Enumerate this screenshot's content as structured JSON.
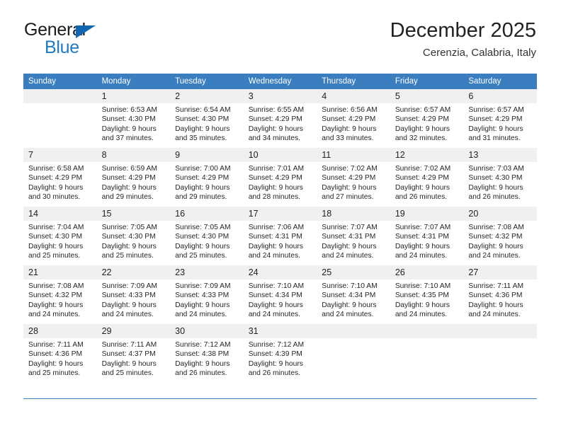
{
  "brand": {
    "name_top": "General",
    "name_bottom": "Blue",
    "accent_color": "#1f7ac4",
    "triangle_color": "#1265b0",
    "triangle_icon": "triangle-right-icon"
  },
  "header": {
    "title": "December 2025",
    "subtitle": "Cerenzia, Calabria, Italy"
  },
  "theme": {
    "header_bg": "#3a7ebf",
    "header_text": "#ffffff",
    "daynum_bg": "#f0f0f0",
    "cell_border": "#3a7ebf"
  },
  "weekday_headers": [
    "Sunday",
    "Monday",
    "Tuesday",
    "Wednesday",
    "Thursday",
    "Friday",
    "Saturday"
  ],
  "weeks": [
    [
      {
        "day": "",
        "sunrise": "",
        "sunset": "",
        "daylight_line1": "",
        "daylight_line2": ""
      },
      {
        "day": "1",
        "sunrise": "Sunrise: 6:53 AM",
        "sunset": "Sunset: 4:30 PM",
        "daylight_line1": "Daylight: 9 hours",
        "daylight_line2": "and 37 minutes."
      },
      {
        "day": "2",
        "sunrise": "Sunrise: 6:54 AM",
        "sunset": "Sunset: 4:30 PM",
        "daylight_line1": "Daylight: 9 hours",
        "daylight_line2": "and 35 minutes."
      },
      {
        "day": "3",
        "sunrise": "Sunrise: 6:55 AM",
        "sunset": "Sunset: 4:29 PM",
        "daylight_line1": "Daylight: 9 hours",
        "daylight_line2": "and 34 minutes."
      },
      {
        "day": "4",
        "sunrise": "Sunrise: 6:56 AM",
        "sunset": "Sunset: 4:29 PM",
        "daylight_line1": "Daylight: 9 hours",
        "daylight_line2": "and 33 minutes."
      },
      {
        "day": "5",
        "sunrise": "Sunrise: 6:57 AM",
        "sunset": "Sunset: 4:29 PM",
        "daylight_line1": "Daylight: 9 hours",
        "daylight_line2": "and 32 minutes."
      },
      {
        "day": "6",
        "sunrise": "Sunrise: 6:57 AM",
        "sunset": "Sunset: 4:29 PM",
        "daylight_line1": "Daylight: 9 hours",
        "daylight_line2": "and 31 minutes."
      }
    ],
    [
      {
        "day": "7",
        "sunrise": "Sunrise: 6:58 AM",
        "sunset": "Sunset: 4:29 PM",
        "daylight_line1": "Daylight: 9 hours",
        "daylight_line2": "and 30 minutes."
      },
      {
        "day": "8",
        "sunrise": "Sunrise: 6:59 AM",
        "sunset": "Sunset: 4:29 PM",
        "daylight_line1": "Daylight: 9 hours",
        "daylight_line2": "and 29 minutes."
      },
      {
        "day": "9",
        "sunrise": "Sunrise: 7:00 AM",
        "sunset": "Sunset: 4:29 PM",
        "daylight_line1": "Daylight: 9 hours",
        "daylight_line2": "and 29 minutes."
      },
      {
        "day": "10",
        "sunrise": "Sunrise: 7:01 AM",
        "sunset": "Sunset: 4:29 PM",
        "daylight_line1": "Daylight: 9 hours",
        "daylight_line2": "and 28 minutes."
      },
      {
        "day": "11",
        "sunrise": "Sunrise: 7:02 AM",
        "sunset": "Sunset: 4:29 PM",
        "daylight_line1": "Daylight: 9 hours",
        "daylight_line2": "and 27 minutes."
      },
      {
        "day": "12",
        "sunrise": "Sunrise: 7:02 AM",
        "sunset": "Sunset: 4:29 PM",
        "daylight_line1": "Daylight: 9 hours",
        "daylight_line2": "and 26 minutes."
      },
      {
        "day": "13",
        "sunrise": "Sunrise: 7:03 AM",
        "sunset": "Sunset: 4:30 PM",
        "daylight_line1": "Daylight: 9 hours",
        "daylight_line2": "and 26 minutes."
      }
    ],
    [
      {
        "day": "14",
        "sunrise": "Sunrise: 7:04 AM",
        "sunset": "Sunset: 4:30 PM",
        "daylight_line1": "Daylight: 9 hours",
        "daylight_line2": "and 25 minutes."
      },
      {
        "day": "15",
        "sunrise": "Sunrise: 7:05 AM",
        "sunset": "Sunset: 4:30 PM",
        "daylight_line1": "Daylight: 9 hours",
        "daylight_line2": "and 25 minutes."
      },
      {
        "day": "16",
        "sunrise": "Sunrise: 7:05 AM",
        "sunset": "Sunset: 4:30 PM",
        "daylight_line1": "Daylight: 9 hours",
        "daylight_line2": "and 25 minutes."
      },
      {
        "day": "17",
        "sunrise": "Sunrise: 7:06 AM",
        "sunset": "Sunset: 4:31 PM",
        "daylight_line1": "Daylight: 9 hours",
        "daylight_line2": "and 24 minutes."
      },
      {
        "day": "18",
        "sunrise": "Sunrise: 7:07 AM",
        "sunset": "Sunset: 4:31 PM",
        "daylight_line1": "Daylight: 9 hours",
        "daylight_line2": "and 24 minutes."
      },
      {
        "day": "19",
        "sunrise": "Sunrise: 7:07 AM",
        "sunset": "Sunset: 4:31 PM",
        "daylight_line1": "Daylight: 9 hours",
        "daylight_line2": "and 24 minutes."
      },
      {
        "day": "20",
        "sunrise": "Sunrise: 7:08 AM",
        "sunset": "Sunset: 4:32 PM",
        "daylight_line1": "Daylight: 9 hours",
        "daylight_line2": "and 24 minutes."
      }
    ],
    [
      {
        "day": "21",
        "sunrise": "Sunrise: 7:08 AM",
        "sunset": "Sunset: 4:32 PM",
        "daylight_line1": "Daylight: 9 hours",
        "daylight_line2": "and 24 minutes."
      },
      {
        "day": "22",
        "sunrise": "Sunrise: 7:09 AM",
        "sunset": "Sunset: 4:33 PM",
        "daylight_line1": "Daylight: 9 hours",
        "daylight_line2": "and 24 minutes."
      },
      {
        "day": "23",
        "sunrise": "Sunrise: 7:09 AM",
        "sunset": "Sunset: 4:33 PM",
        "daylight_line1": "Daylight: 9 hours",
        "daylight_line2": "and 24 minutes."
      },
      {
        "day": "24",
        "sunrise": "Sunrise: 7:10 AM",
        "sunset": "Sunset: 4:34 PM",
        "daylight_line1": "Daylight: 9 hours",
        "daylight_line2": "and 24 minutes."
      },
      {
        "day": "25",
        "sunrise": "Sunrise: 7:10 AM",
        "sunset": "Sunset: 4:34 PM",
        "daylight_line1": "Daylight: 9 hours",
        "daylight_line2": "and 24 minutes."
      },
      {
        "day": "26",
        "sunrise": "Sunrise: 7:10 AM",
        "sunset": "Sunset: 4:35 PM",
        "daylight_line1": "Daylight: 9 hours",
        "daylight_line2": "and 24 minutes."
      },
      {
        "day": "27",
        "sunrise": "Sunrise: 7:11 AM",
        "sunset": "Sunset: 4:36 PM",
        "daylight_line1": "Daylight: 9 hours",
        "daylight_line2": "and 24 minutes."
      }
    ],
    [
      {
        "day": "28",
        "sunrise": "Sunrise: 7:11 AM",
        "sunset": "Sunset: 4:36 PM",
        "daylight_line1": "Daylight: 9 hours",
        "daylight_line2": "and 25 minutes."
      },
      {
        "day": "29",
        "sunrise": "Sunrise: 7:11 AM",
        "sunset": "Sunset: 4:37 PM",
        "daylight_line1": "Daylight: 9 hours",
        "daylight_line2": "and 25 minutes."
      },
      {
        "day": "30",
        "sunrise": "Sunrise: 7:12 AM",
        "sunset": "Sunset: 4:38 PM",
        "daylight_line1": "Daylight: 9 hours",
        "daylight_line2": "and 26 minutes."
      },
      {
        "day": "31",
        "sunrise": "Sunrise: 7:12 AM",
        "sunset": "Sunset: 4:39 PM",
        "daylight_line1": "Daylight: 9 hours",
        "daylight_line2": "and 26 minutes."
      },
      {
        "day": "",
        "sunrise": "",
        "sunset": "",
        "daylight_line1": "",
        "daylight_line2": ""
      },
      {
        "day": "",
        "sunrise": "",
        "sunset": "",
        "daylight_line1": "",
        "daylight_line2": ""
      },
      {
        "day": "",
        "sunrise": "",
        "sunset": "",
        "daylight_line1": "",
        "daylight_line2": ""
      }
    ]
  ]
}
